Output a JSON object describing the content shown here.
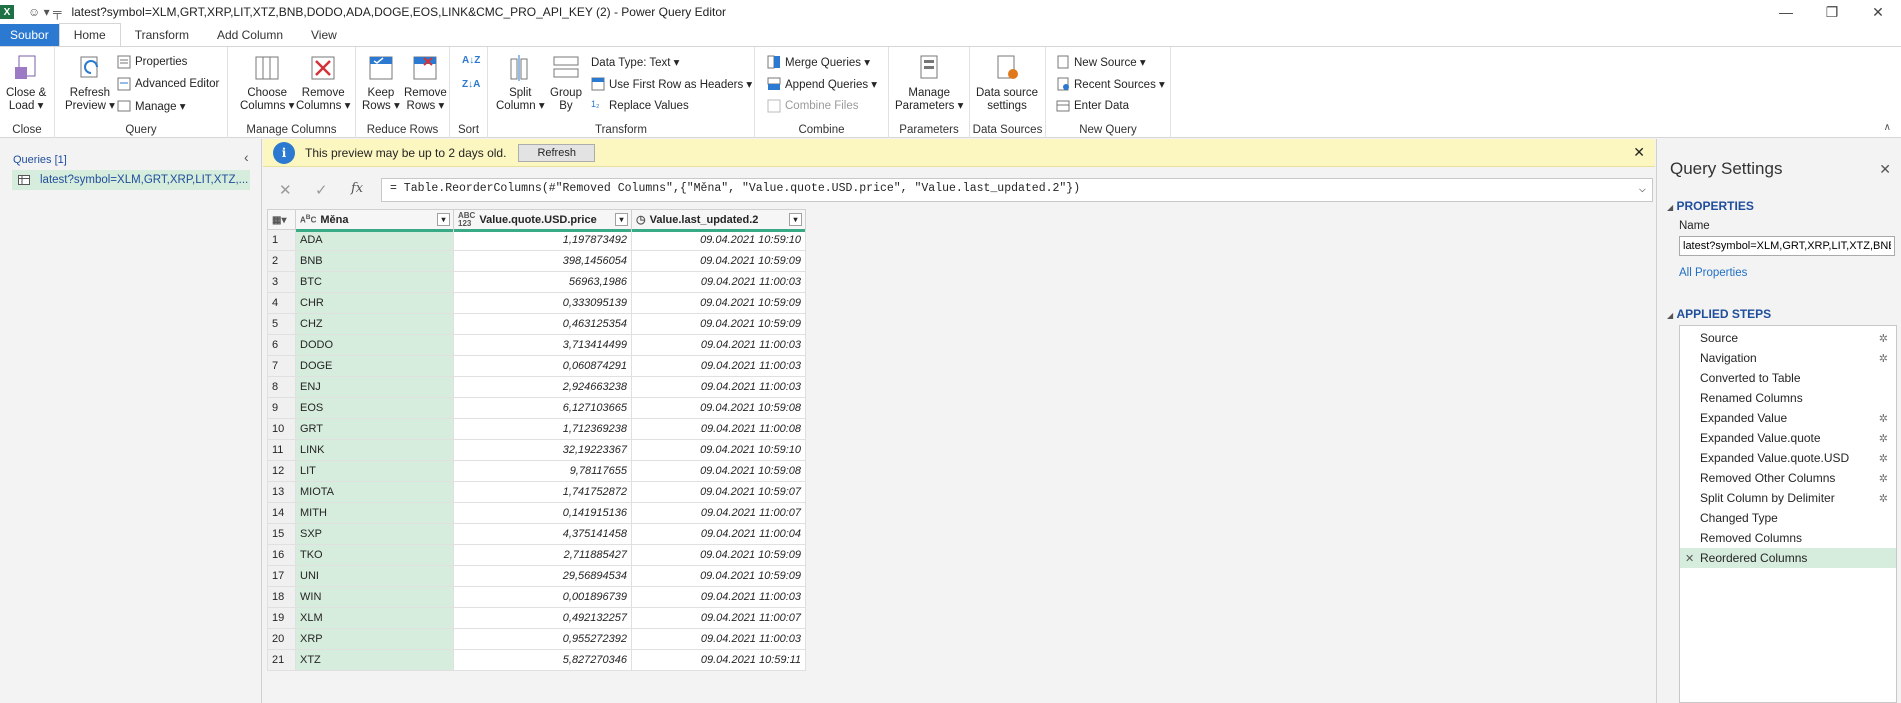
{
  "window": {
    "title": "latest?symbol=XLM,GRT,XRP,LIT,XTZ,BNB,DODO,ADA,DOGE,EOS,LINK&CMC_PRO_API_KEY (2) - Power Query Editor",
    "quick_access": "☺ ▾ ╤"
  },
  "tabs": [
    "Soubor",
    "Home",
    "Transform",
    "Add Column",
    "View"
  ],
  "ribbon": {
    "close": {
      "close_load": "Close &\nLoad ▾",
      "label": "Close"
    },
    "query": {
      "refresh": "Refresh\nPreview ▾",
      "properties": "Properties",
      "advanced": "Advanced Editor",
      "manage": "Manage ▾",
      "label": "Query"
    },
    "manage_columns": {
      "choose": "Choose\nColumns ▾",
      "remove": "Remove\nColumns ▾",
      "label": "Manage Columns"
    },
    "reduce_rows": {
      "keep": "Keep\nRows ▾",
      "remove": "Remove\nRows ▾",
      "label": "Reduce Rows"
    },
    "sort": {
      "label": "Sort"
    },
    "transform": {
      "split": "Split\nColumn ▾",
      "group": "Group\nBy",
      "datatype": "Data Type: Text ▾",
      "first_row": "Use First Row as Headers ▾",
      "replace": "Replace Values",
      "label": "Transform"
    },
    "combine": {
      "merge": "Merge Queries ▾",
      "append": "Append Queries ▾",
      "files": "Combine Files",
      "label": "Combine"
    },
    "parameters": {
      "manage": "Manage\nParameters ▾",
      "label": "Parameters"
    },
    "data_sources": {
      "settings": "Data source\nsettings",
      "label": "Data Sources"
    },
    "new_query": {
      "new_source": "New Source ▾",
      "recent": "Recent Sources ▾",
      "enter": "Enter Data",
      "label": "New Query"
    }
  },
  "queries": {
    "header": "Queries [1]",
    "items": [
      "latest?symbol=XLM,GRT,XRP,LIT,XTZ,..."
    ]
  },
  "info": {
    "message": "This preview may be up to 2 days old.",
    "refresh": "Refresh"
  },
  "formula": "= Table.ReorderColumns(#\"Removed Columns\",{\"Měna\", \"Value.quote.USD.price\", \"Value.last_updated.2\"})",
  "grid": {
    "columns": [
      {
        "name": "Měna",
        "type": "ABC"
      },
      {
        "name": "Value.quote.USD.price",
        "type": "ABC 123"
      },
      {
        "name": "Value.last_updated.2",
        "type": "date"
      }
    ],
    "rows": [
      [
        "1",
        "ADA",
        "1,197873492",
        "09.04.2021 10:59:10"
      ],
      [
        "2",
        "BNB",
        "398,1456054",
        "09.04.2021 10:59:09"
      ],
      [
        "3",
        "BTC",
        "56963,1986",
        "09.04.2021 11:00:03"
      ],
      [
        "4",
        "CHR",
        "0,333095139",
        "09.04.2021 10:59:09"
      ],
      [
        "5",
        "CHZ",
        "0,463125354",
        "09.04.2021 10:59:09"
      ],
      [
        "6",
        "DODO",
        "3,713414499",
        "09.04.2021 11:00:03"
      ],
      [
        "7",
        "DOGE",
        "0,060874291",
        "09.04.2021 11:00:03"
      ],
      [
        "8",
        "ENJ",
        "2,924663238",
        "09.04.2021 11:00:03"
      ],
      [
        "9",
        "EOS",
        "6,127103665",
        "09.04.2021 10:59:08"
      ],
      [
        "10",
        "GRT",
        "1,712369238",
        "09.04.2021 11:00:08"
      ],
      [
        "11",
        "LINK",
        "32,19223367",
        "09.04.2021 10:59:10"
      ],
      [
        "12",
        "LIT",
        "9,78117655",
        "09.04.2021 10:59:08"
      ],
      [
        "13",
        "MIOTA",
        "1,741752872",
        "09.04.2021 10:59:07"
      ],
      [
        "14",
        "MITH",
        "0,141915136",
        "09.04.2021 11:00:07"
      ],
      [
        "15",
        "SXP",
        "4,375141458",
        "09.04.2021 11:00:04"
      ],
      [
        "16",
        "TKO",
        "2,711885427",
        "09.04.2021 10:59:09"
      ],
      [
        "17",
        "UNI",
        "29,56894534",
        "09.04.2021 10:59:09"
      ],
      [
        "18",
        "WIN",
        "0,001896739",
        "09.04.2021 11:00:03"
      ],
      [
        "19",
        "XLM",
        "0,492132257",
        "09.04.2021 11:00:07"
      ],
      [
        "20",
        "XRP",
        "0,955272392",
        "09.04.2021 11:00:03"
      ],
      [
        "21",
        "XTZ",
        "5,827270346",
        "09.04.2021 10:59:11"
      ]
    ]
  },
  "settings": {
    "title": "Query Settings",
    "properties": "PROPERTIES",
    "name_label": "Name",
    "name_value": "latest?symbol=XLM,GRT,XRP,LIT,XTZ,BNB",
    "all_properties": "All Properties",
    "applied_steps": "APPLIED STEPS",
    "steps": [
      {
        "name": "Source",
        "gear": true
      },
      {
        "name": "Navigation",
        "gear": true
      },
      {
        "name": "Converted to Table",
        "gear": false
      },
      {
        "name": "Renamed Columns",
        "gear": false
      },
      {
        "name": "Expanded Value",
        "gear": true
      },
      {
        "name": "Expanded Value.quote",
        "gear": true
      },
      {
        "name": "Expanded Value.quote.USD",
        "gear": true
      },
      {
        "name": "Removed Other Columns",
        "gear": true
      },
      {
        "name": "Split Column by Delimiter",
        "gear": true
      },
      {
        "name": "Changed Type",
        "gear": false
      },
      {
        "name": "Removed Columns",
        "gear": false
      },
      {
        "name": "Reordered Columns",
        "gear": false,
        "selected": true
      }
    ]
  },
  "colors": {
    "accent": "#2b79d0",
    "selected": "#d6ecdc",
    "quality": "#3aa985",
    "info_bg": "#fcf6c0"
  }
}
